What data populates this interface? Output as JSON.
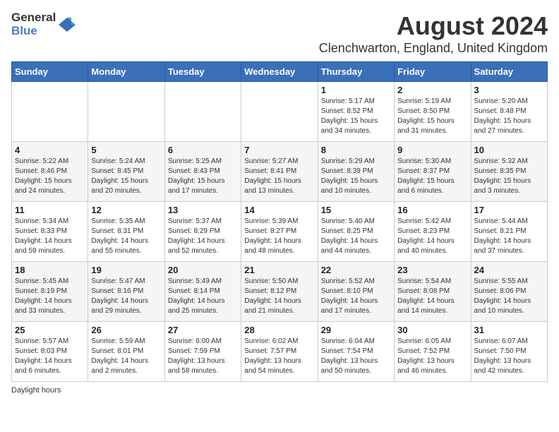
{
  "header": {
    "logo_general": "General",
    "logo_blue": "Blue",
    "title": "August 2024",
    "subtitle": "Clenchwarton, England, United Kingdom"
  },
  "days_of_week": [
    "Sunday",
    "Monday",
    "Tuesday",
    "Wednesday",
    "Thursday",
    "Friday",
    "Saturday"
  ],
  "weeks": [
    [
      {
        "day": "",
        "info": ""
      },
      {
        "day": "",
        "info": ""
      },
      {
        "day": "",
        "info": ""
      },
      {
        "day": "",
        "info": ""
      },
      {
        "day": "1",
        "info": "Sunrise: 5:17 AM\nSunset: 8:52 PM\nDaylight: 15 hours and 34 minutes."
      },
      {
        "day": "2",
        "info": "Sunrise: 5:19 AM\nSunset: 8:50 PM\nDaylight: 15 hours and 31 minutes."
      },
      {
        "day": "3",
        "info": "Sunrise: 5:20 AM\nSunset: 8:48 PM\nDaylight: 15 hours and 27 minutes."
      }
    ],
    [
      {
        "day": "4",
        "info": "Sunrise: 5:22 AM\nSunset: 8:46 PM\nDaylight: 15 hours and 24 minutes."
      },
      {
        "day": "5",
        "info": "Sunrise: 5:24 AM\nSunset: 8:45 PM\nDaylight: 15 hours and 20 minutes."
      },
      {
        "day": "6",
        "info": "Sunrise: 5:25 AM\nSunset: 8:43 PM\nDaylight: 15 hours and 17 minutes."
      },
      {
        "day": "7",
        "info": "Sunrise: 5:27 AM\nSunset: 8:41 PM\nDaylight: 15 hours and 13 minutes."
      },
      {
        "day": "8",
        "info": "Sunrise: 5:29 AM\nSunset: 8:39 PM\nDaylight: 15 hours and 10 minutes."
      },
      {
        "day": "9",
        "info": "Sunrise: 5:30 AM\nSunset: 8:37 PM\nDaylight: 15 hours and 6 minutes."
      },
      {
        "day": "10",
        "info": "Sunrise: 5:32 AM\nSunset: 8:35 PM\nDaylight: 15 hours and 3 minutes."
      }
    ],
    [
      {
        "day": "11",
        "info": "Sunrise: 5:34 AM\nSunset: 8:33 PM\nDaylight: 14 hours and 59 minutes."
      },
      {
        "day": "12",
        "info": "Sunrise: 5:35 AM\nSunset: 8:31 PM\nDaylight: 14 hours and 55 minutes."
      },
      {
        "day": "13",
        "info": "Sunrise: 5:37 AM\nSunset: 8:29 PM\nDaylight: 14 hours and 52 minutes."
      },
      {
        "day": "14",
        "info": "Sunrise: 5:39 AM\nSunset: 8:27 PM\nDaylight: 14 hours and 48 minutes."
      },
      {
        "day": "15",
        "info": "Sunrise: 5:40 AM\nSunset: 8:25 PM\nDaylight: 14 hours and 44 minutes."
      },
      {
        "day": "16",
        "info": "Sunrise: 5:42 AM\nSunset: 8:23 PM\nDaylight: 14 hours and 40 minutes."
      },
      {
        "day": "17",
        "info": "Sunrise: 5:44 AM\nSunset: 8:21 PM\nDaylight: 14 hours and 37 minutes."
      }
    ],
    [
      {
        "day": "18",
        "info": "Sunrise: 5:45 AM\nSunset: 8:19 PM\nDaylight: 14 hours and 33 minutes."
      },
      {
        "day": "19",
        "info": "Sunrise: 5:47 AM\nSunset: 8:16 PM\nDaylight: 14 hours and 29 minutes."
      },
      {
        "day": "20",
        "info": "Sunrise: 5:49 AM\nSunset: 8:14 PM\nDaylight: 14 hours and 25 minutes."
      },
      {
        "day": "21",
        "info": "Sunrise: 5:50 AM\nSunset: 8:12 PM\nDaylight: 14 hours and 21 minutes."
      },
      {
        "day": "22",
        "info": "Sunrise: 5:52 AM\nSunset: 8:10 PM\nDaylight: 14 hours and 17 minutes."
      },
      {
        "day": "23",
        "info": "Sunrise: 5:54 AM\nSunset: 8:08 PM\nDaylight: 14 hours and 14 minutes."
      },
      {
        "day": "24",
        "info": "Sunrise: 5:55 AM\nSunset: 8:06 PM\nDaylight: 14 hours and 10 minutes."
      }
    ],
    [
      {
        "day": "25",
        "info": "Sunrise: 5:57 AM\nSunset: 8:03 PM\nDaylight: 14 hours and 6 minutes."
      },
      {
        "day": "26",
        "info": "Sunrise: 5:59 AM\nSunset: 8:01 PM\nDaylight: 14 hours and 2 minutes."
      },
      {
        "day": "27",
        "info": "Sunrise: 6:00 AM\nSunset: 7:59 PM\nDaylight: 13 hours and 58 minutes."
      },
      {
        "day": "28",
        "info": "Sunrise: 6:02 AM\nSunset: 7:57 PM\nDaylight: 13 hours and 54 minutes."
      },
      {
        "day": "29",
        "info": "Sunrise: 6:04 AM\nSunset: 7:54 PM\nDaylight: 13 hours and 50 minutes."
      },
      {
        "day": "30",
        "info": "Sunrise: 6:05 AM\nSunset: 7:52 PM\nDaylight: 13 hours and 46 minutes."
      },
      {
        "day": "31",
        "info": "Sunrise: 6:07 AM\nSunset: 7:50 PM\nDaylight: 13 hours and 42 minutes."
      }
    ]
  ],
  "footer": "Daylight hours"
}
